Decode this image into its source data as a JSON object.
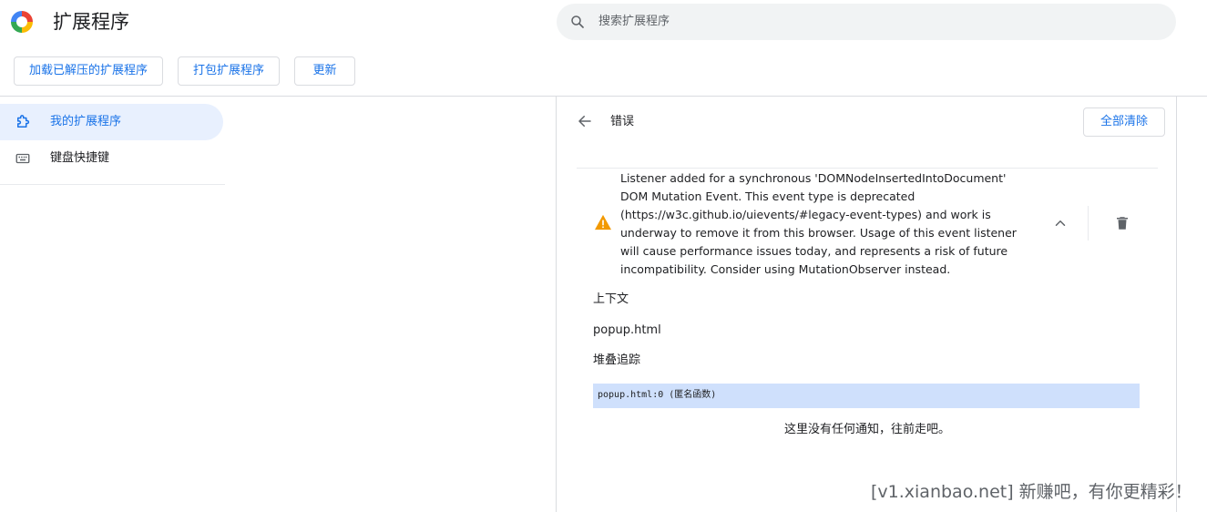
{
  "header": {
    "title": "扩展程序",
    "search_placeholder": "搜索扩展程序"
  },
  "toolbar": {
    "load_unpacked": "加载已解压的扩展程序",
    "pack": "打包扩展程序",
    "update": "更新"
  },
  "sidebar": {
    "items": [
      {
        "label": "我的扩展程序",
        "icon": "extension-icon"
      },
      {
        "label": "键盘快捷键",
        "icon": "keyboard-icon"
      }
    ]
  },
  "errors_panel": {
    "title": "错误",
    "clear_all": "全部清除",
    "message": "Listener added for a synchronous 'DOMNodeInsertedIntoDocument' DOM Mutation Event. This event type is deprecated (https://w3c.github.io/uievents/#legacy-event-types) and work is underway to remove it from this browser. Usage of this event listener will cause performance issues today, and represents a risk of future incompatibility. Consider using MutationObserver instead.",
    "context_label": "上下文",
    "context_value": "popup.html",
    "stack_label": "堆叠追踪",
    "stack_line": "popup.html:0 (匿名函数)",
    "no_more": "这里没有任何通知，往前走吧。"
  },
  "watermark": "[v1.xianbao.net] 新赚吧，有你更精彩！",
  "colors": {
    "accent": "#1a73e8",
    "active_bg": "#e8f0fe",
    "stack_highlight": "#cfe0fc",
    "warning": "#f29900"
  }
}
